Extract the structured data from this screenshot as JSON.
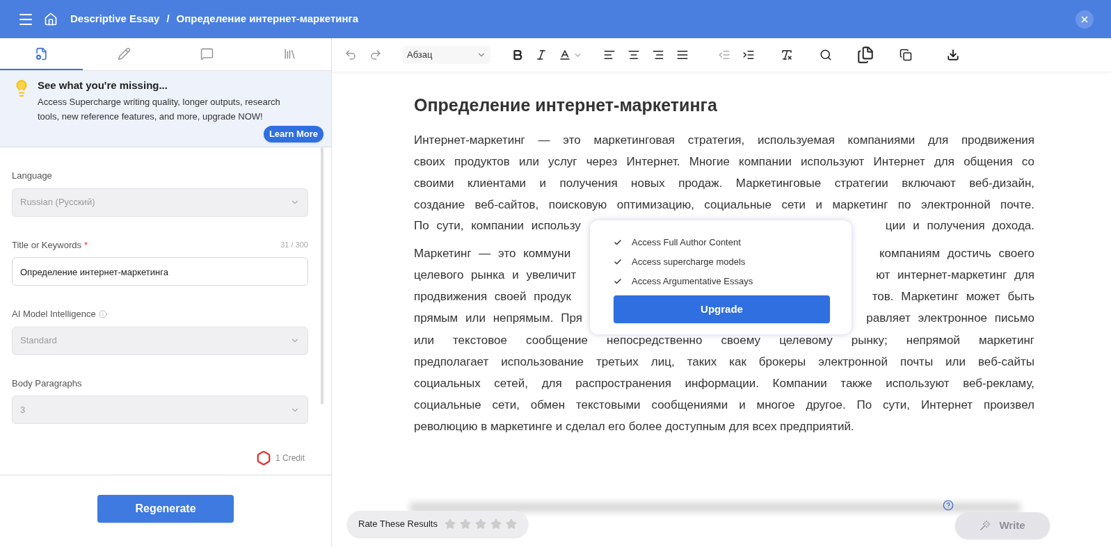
{
  "header": {
    "breadcrumb": [
      "Descriptive Essay",
      "Определение интернет-маркетинга"
    ],
    "separator": "/"
  },
  "sidebar": {
    "tabs": [
      {
        "kind": "settings",
        "selected": true
      },
      {
        "kind": "edit",
        "selected": false
      },
      {
        "kind": "comments",
        "selected": false
      },
      {
        "kind": "library",
        "selected": false
      }
    ],
    "promo": {
      "title": "See what you're missing...",
      "text": "Access Supercharge writing quality, longer outputs, research tools, new reference features, and more, upgrade NOW!",
      "button": "Learn More"
    },
    "fields": [
      {
        "kind": "select",
        "label": "Language",
        "value": "Russian (Русский)",
        "disabled": true
      },
      {
        "kind": "textarea",
        "label": "Title or Keywords",
        "required_mark": "*",
        "counter": "31 / 300",
        "value": "Определение интернет-маркетинга",
        "disabled": false
      },
      {
        "kind": "select",
        "label": "AI Model Intelligence",
        "info": true,
        "value": "Standard",
        "disabled": true
      },
      {
        "kind": "select",
        "label": "Body Paragraphs",
        "value": "3",
        "disabled": true
      }
    ],
    "credit": "1 Credit",
    "button": "Regenerate"
  },
  "toolbar": {
    "block_format": "Абзац"
  },
  "document": {
    "title": "Определение интернет-маркетинга",
    "paragraphs": [
      [
        {
          "left": "Интернет-маркетинг — это маркетинговая стратегия, используемая компаниями для продвижения"
        },
        {
          "left": "своих продуктов или услуг через Интернет. Многие компании используют Интернет для общения со"
        },
        {
          "left": "своими клиентами и получения новых продаж. Маркетинговые стратегии включают веб-дизайн,"
        },
        {
          "left": "создание веб-сайтов, поисковую оптимизацию, социальные сети и маркетинг по электронной почте."
        },
        {
          "left": "По сути, компании использу",
          "right": "ции и получения дохода."
        }
      ],
      [
        {
          "left": "Маркетинг — это коммуни",
          "right": "компаниям достичь своего"
        },
        {
          "left": "целевого рынка и увеличит",
          "right": "ют интернет-маркетинг для"
        },
        {
          "left": "продвижения своей продук",
          "right": "тов. Маркетинг может быть"
        },
        {
          "left": "прямым или непрямым. Пря",
          "right": "равляет электронное письмо"
        },
        {
          "left": "или текстовое сообщение непосредственно своему целевому рынку; непрямой маркетинг"
        },
        {
          "left": "предполагает использование третьих лиц, таких как брокеры электронной почты или веб-сайты"
        },
        {
          "left": "социальных сетей, для распространения информации. Компании также используют веб-рекламу,"
        },
        {
          "left": "социальные сети, обмен текстовыми сообщениями и многое другое. По сути, Интернет произвел"
        },
        {
          "left": "революцию в маркетинге и сделал его более доступным для всех предприятий.",
          "last": true
        }
      ]
    ]
  },
  "upgrade_popup": {
    "features": [
      "Access Full Author Content",
      "Access supercharge models",
      "Access Argumentative Essays"
    ],
    "button": "Upgrade"
  },
  "rating": {
    "label": "Rate These Results",
    "stars": 0
  },
  "write_button": {
    "label": "Write",
    "disabled": true
  }
}
